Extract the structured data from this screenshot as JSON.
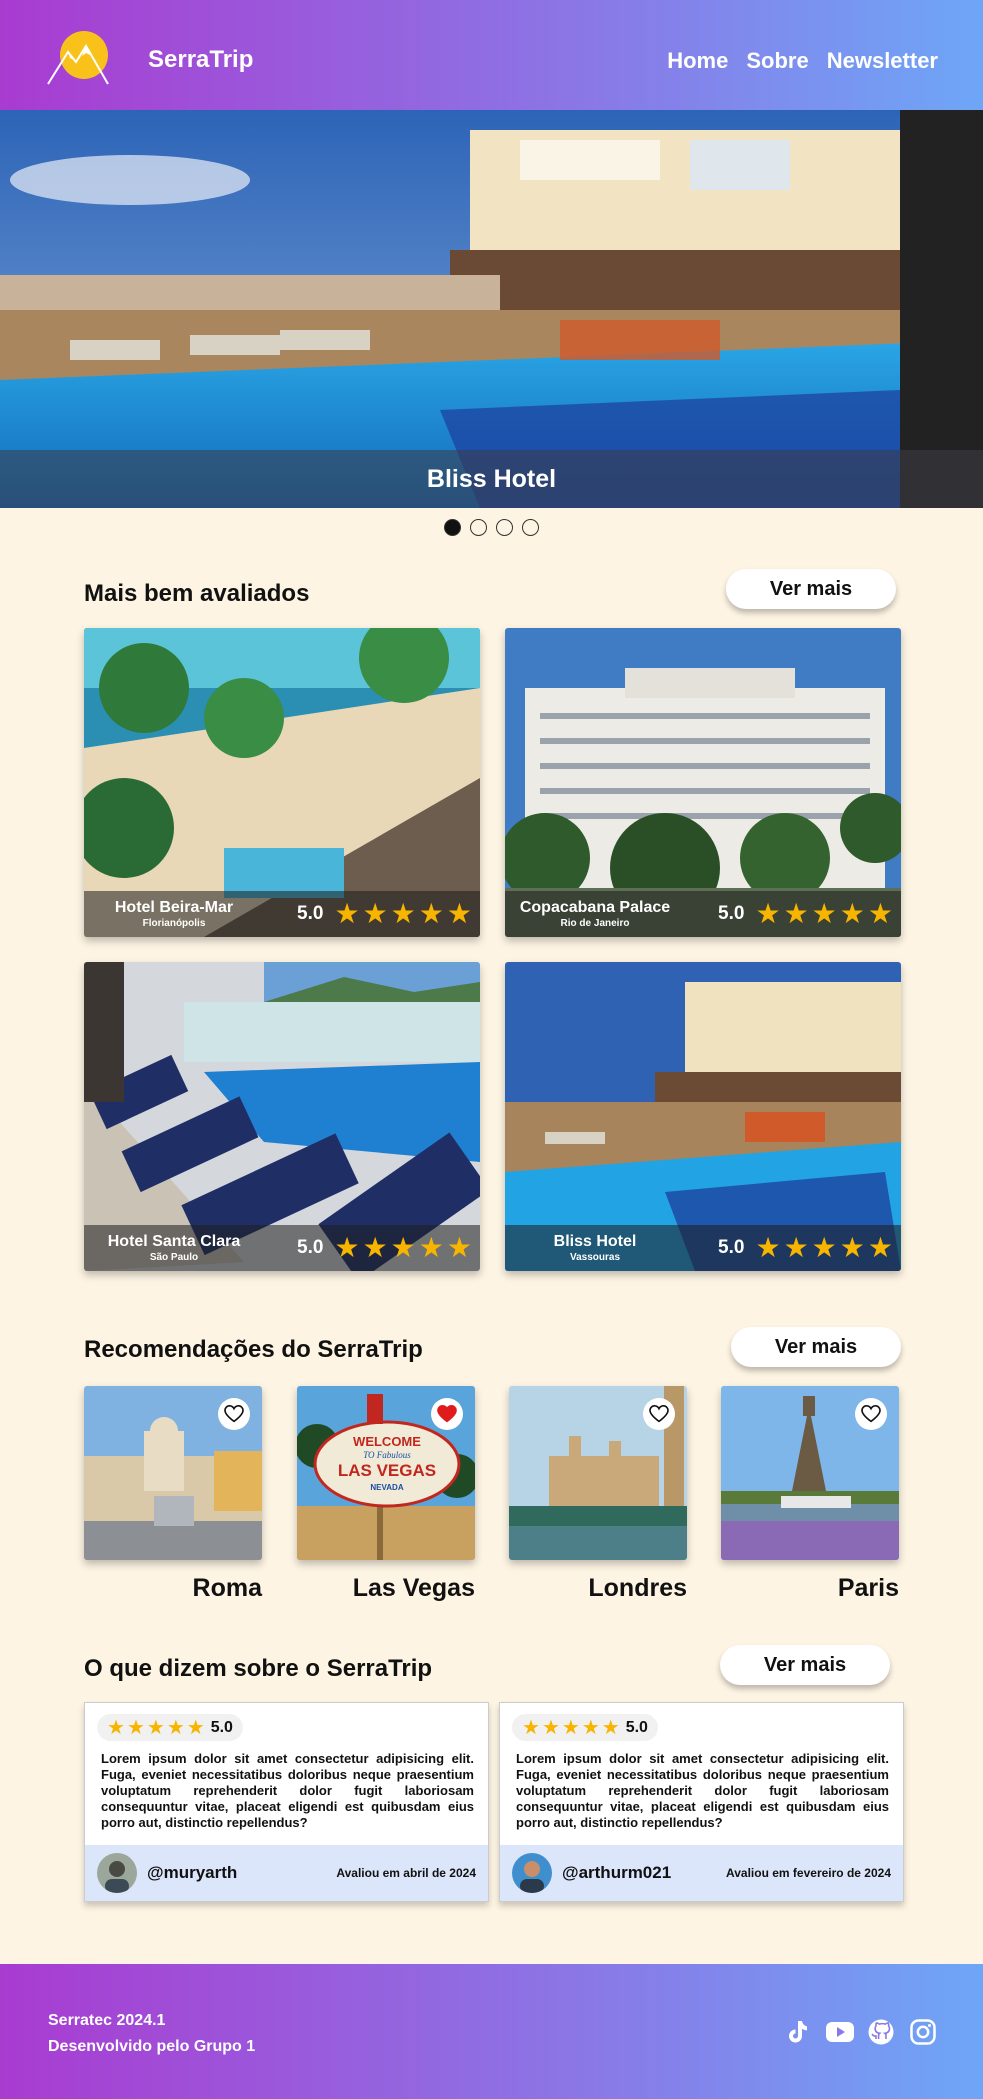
{
  "header": {
    "brand": "SerraTrip",
    "nav": [
      "Home",
      "Sobre",
      "Newsletter"
    ]
  },
  "hero": {
    "caption": "Bliss Hotel",
    "slide_count": 4,
    "active_slide": 1
  },
  "top_rated": {
    "title": "Mais bem avaliados",
    "more_label": "Ver mais",
    "hotels": [
      {
        "name": "Hotel Beira-Mar",
        "city": "Florianópolis",
        "score": "5.0",
        "stars": 5
      },
      {
        "name": "Copacabana Palace",
        "city": "Rio de Janeiro",
        "score": "5.0",
        "stars": 5
      },
      {
        "name": "Hotel Santa Clara",
        "city": "São Paulo",
        "score": "5.0",
        "stars": 5
      },
      {
        "name": "Bliss Hotel",
        "city": "Vassouras",
        "score": "5.0",
        "stars": 5
      }
    ]
  },
  "recommendations": {
    "title": "Recomendações do SerraTrip",
    "more_label": "Ver mais",
    "places": [
      {
        "name": "Roma",
        "favorited": false
      },
      {
        "name": "Las Vegas",
        "favorited": true
      },
      {
        "name": "Londres",
        "favorited": false
      },
      {
        "name": "Paris",
        "favorited": false
      }
    ],
    "sign_text": [
      "WELCOME",
      "TO Fabulous",
      "LAS VEGAS",
      "NEVADA"
    ]
  },
  "reviews": {
    "title": "O que dizem sobre o SerraTrip",
    "more_label": "Ver mais",
    "items": [
      {
        "score": "5.0",
        "stars": 5,
        "text": "Lorem ipsum dolor sit amet consectetur adipisicing elit. Fuga, eveniet necessitatibus doloribus neque praesentium voluptatum reprehenderit dolor fugit laboriosam consequuntur vitae, placeat eligendi est quibusdam eius porro aut, distinctio repellendus?",
        "handle": "@muryarth",
        "when": "Avaliou em abril de 2024"
      },
      {
        "score": "5.0",
        "stars": 5,
        "text": "Lorem ipsum dolor sit amet consectetur adipisicing elit. Fuga, eveniet necessitatibus doloribus neque praesentium voluptatum reprehenderit dolor fugit laboriosam consequuntur vitae, placeat eligendi est quibusdam eius porro aut, distinctio repellendus?",
        "handle": "@arthurm021",
        "when": "Avaliou em fevereiro de 2024"
      }
    ]
  },
  "footer": {
    "line1": "Serratec 2024.1",
    "line2": "Desenvolvido pelo Grupo 1",
    "social_icons": [
      "tiktok-icon",
      "youtube-icon",
      "github-icon",
      "instagram-icon"
    ]
  },
  "colors": {
    "gradient_start": "#a93bd1",
    "gradient_end": "#6ea6f7",
    "background": "#fdf4e3",
    "star": "#f7b500",
    "heart_active": "#e01b1b",
    "review_footer": "#dce6fb"
  }
}
